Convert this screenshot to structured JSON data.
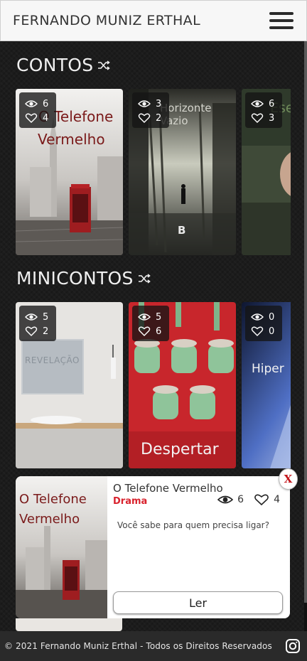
{
  "header": {
    "site_title": "FERNANDO MUNIZ ERTHAL",
    "menu_icon": "hamburger-icon"
  },
  "sections": {
    "contos": {
      "title": "CONTOS",
      "icon": "shuffle-icon",
      "cards": [
        {
          "cover_title_line1": "O Telefone",
          "cover_title_line2": "Vermelho",
          "views": "6",
          "likes": "4"
        },
        {
          "cover_title_line1": "Horizonte Vazio",
          "cover_mark": "B",
          "views": "3",
          "likes": "2"
        },
        {
          "cover_title_line1": "Ese",
          "views": "6",
          "likes": "3"
        }
      ]
    },
    "minicontos": {
      "title": "MINICONTOS",
      "icon": "shuffle-icon",
      "cards": [
        {
          "cover_title_line1": "REVELAÇÃO",
          "views": "5",
          "likes": "2"
        },
        {
          "cover_title_line1": "Despertar",
          "views": "5",
          "likes": "6"
        },
        {
          "cover_title_line1": "Hiper",
          "views": "0",
          "likes": "0"
        }
      ]
    }
  },
  "popup": {
    "cover_title_line1": "O Telefone",
    "cover_title_line2": "Vermelho",
    "title": "O Telefone Vermelho",
    "genre": "Drama",
    "views": "6",
    "likes": "4",
    "description": "Você sabe para quem precisa ligar?",
    "read_label": "Ler",
    "close_label": "X"
  },
  "footer": {
    "copyright": "© 2021 Fernando Muniz Erthal - Todos os Direitos Reservados",
    "social_icon": "instagram-icon"
  },
  "colors": {
    "background": "#1c1c1c",
    "header_bg": "#f7f7f7",
    "genre_red": "#d9232e",
    "cover_red": "#7a1a1a",
    "footer_bg": "#2a2a2a"
  }
}
